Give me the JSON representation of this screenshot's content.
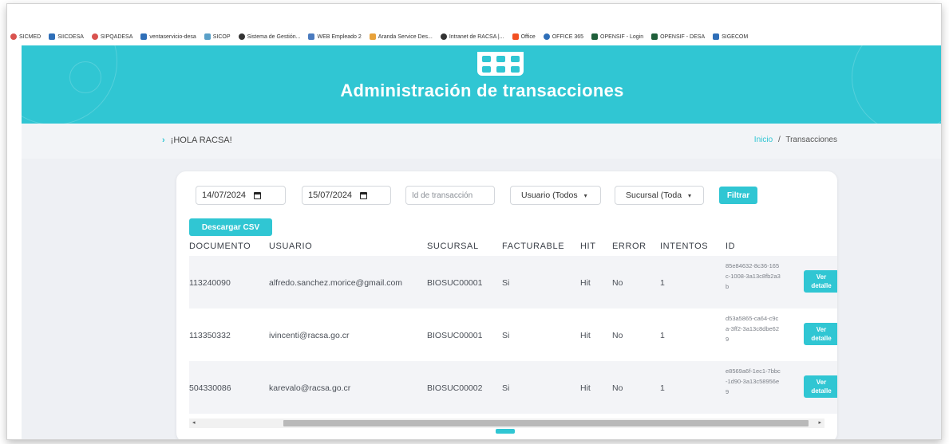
{
  "bookmarks": [
    {
      "label": "SICMED",
      "icon": "circle-icon",
      "color": "#d9534f"
    },
    {
      "label": "SIICDESA",
      "icon": "triangle-icon",
      "color": "#2f6fb8"
    },
    {
      "label": "SIPQADESA",
      "icon": "circle-icon",
      "color": "#d9534f"
    },
    {
      "label": "ventaservicio-desa",
      "icon": "triangle-icon",
      "color": "#2f6fb8"
    },
    {
      "label": "SICOP",
      "icon": "heart-icon",
      "color": "#5aa0c8"
    },
    {
      "label": "Sistema de Gestión...",
      "icon": "globe-icon",
      "color": "#333333"
    },
    {
      "label": "WEB Empleado 2",
      "icon": "puzzle-icon",
      "color": "#4a7bbf"
    },
    {
      "label": "Aranda Service Des...",
      "icon": "flower-icon",
      "color": "#e8a23a"
    },
    {
      "label": "Intranet de RACSA |...",
      "icon": "globe-icon",
      "color": "#333333"
    },
    {
      "label": "Office",
      "icon": "office-icon",
      "color": "#f25022"
    },
    {
      "label": "OFFICE 365",
      "icon": "circle-icon",
      "color": "#2f6fb8"
    },
    {
      "label": "OPENSIF - Login",
      "icon": "card-icon",
      "color": "#1f5f3a"
    },
    {
      "label": "OPENSIF - DESA",
      "icon": "card-icon",
      "color": "#1f5f3a"
    },
    {
      "label": "SIGECOM",
      "icon": "triangle-icon",
      "color": "#2f6fb8"
    }
  ],
  "header": {
    "title": "Administración de transacciones"
  },
  "greeting": "¡HOLA RACSA!",
  "breadcrumb": {
    "home": "Inicio",
    "separator": "/",
    "current": "Transacciones"
  },
  "filters": {
    "date_from": "14/07/2024",
    "date_to": "15/07/2024",
    "transaction_id_placeholder": "Id de transacción",
    "user_select": "Usuario (Todos",
    "branch_select": "Sucursal (Toda",
    "filter_button": "Filtrar",
    "csv_button": "Descargar CSV"
  },
  "table": {
    "columns": [
      "DOCUMENTO",
      "USUARIO",
      "SUCURSAL",
      "FACTURABLE",
      "HIT",
      "ERROR",
      "INTENTOS",
      "ID"
    ],
    "rows": [
      {
        "documento": "113240090",
        "usuario": "alfredo.sanchez.morice@gmail.com",
        "sucursal": "BIOSUC00001",
        "facturable": "Si",
        "hit": "Hit",
        "error": "No",
        "intentos": "1",
        "id": "85e84632-8c36-165c-1008-3a13c8fb2a3b"
      },
      {
        "documento": "113350332",
        "usuario": "ivincenti@racsa.go.cr",
        "sucursal": "BIOSUC00001",
        "facturable": "Si",
        "hit": "Hit",
        "error": "No",
        "intentos": "1",
        "id": "d53a5865-ca64-c9ca-3ff2-3a13c8dbe629"
      },
      {
        "documento": "504330086",
        "usuario": "karevalo@racsa.go.cr",
        "sucursal": "BIOSUC00002",
        "facturable": "Si",
        "hit": "Hit",
        "error": "No",
        "intentos": "1",
        "id": "e8569a6f-1ec1-7bbc-1d90-3a13c58956e9"
      }
    ],
    "detail_label_1": "Ver",
    "detail_label_2": "detalle"
  },
  "colors": {
    "accent": "#30c6d3"
  }
}
